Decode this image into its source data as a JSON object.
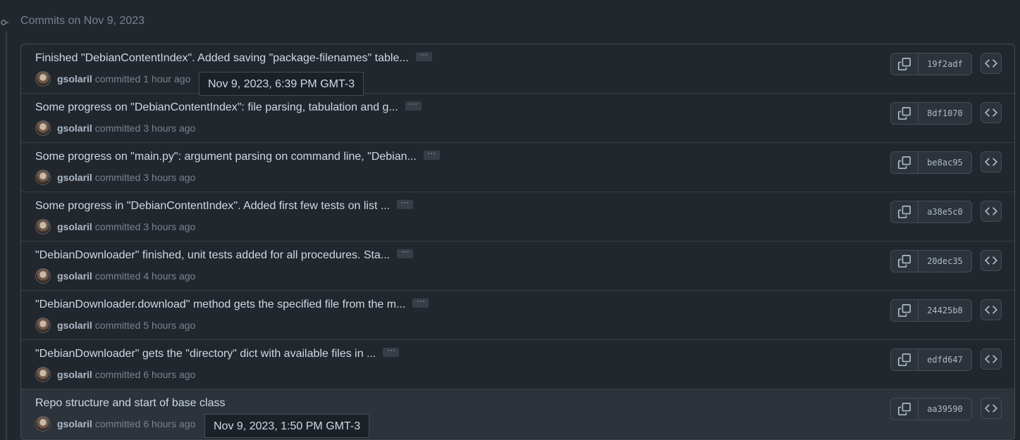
{
  "group": {
    "heading": "Commits on Nov 9, 2023"
  },
  "commits": [
    {
      "title": "Finished \"DebianContentIndex\". Added saving \"package-filenames\" table...",
      "ellipsis": "···",
      "author": "gsolaril",
      "verb": "committed",
      "time": "1 hour ago",
      "sha": "19f2adf"
    },
    {
      "title": "Some progress on \"DebianContentIndex\": file parsing, tabulation and g...",
      "ellipsis": "···",
      "author": "gsolaril",
      "verb": "committed",
      "time": "3 hours ago",
      "sha": "8df1070"
    },
    {
      "title": "Some progress on \"main.py\": argument parsing on command line, \"Debian...",
      "ellipsis": "···",
      "author": "gsolaril",
      "verb": "committed",
      "time": "3 hours ago",
      "sha": "be8ac95"
    },
    {
      "title": "Some progress in \"DebianContentIndex\". Added first few tests on list ...",
      "ellipsis": "···",
      "author": "gsolaril",
      "verb": "committed",
      "time": "3 hours ago",
      "sha": "a38e5c0"
    },
    {
      "title": "\"DebianDownloader\" finished, unit tests added for all procedures. Sta...",
      "ellipsis": "···",
      "author": "gsolaril",
      "verb": "committed",
      "time": "4 hours ago",
      "sha": "20dec35"
    },
    {
      "title": "\"DebianDownloader.download\" method gets the specified file from the m...",
      "ellipsis": "···",
      "author": "gsolaril",
      "verb": "committed",
      "time": "5 hours ago",
      "sha": "24425b8"
    },
    {
      "title": "\"DebianDownloader\" gets the \"directory\" dict with available files in ...",
      "ellipsis": "···",
      "author": "gsolaril",
      "verb": "committed",
      "time": "6 hours ago",
      "sha": "edfd647"
    },
    {
      "title": "Repo structure and start of base class",
      "ellipsis": "",
      "author": "gsolaril",
      "verb": "committed",
      "time": "6 hours ago",
      "sha": "aa39590"
    }
  ],
  "tooltips": {
    "first": "Nov 9, 2023, 6:39 PM GMT-3",
    "last": "Nov 9, 2023, 1:50 PM GMT-3"
  },
  "icons": {
    "copy": "copy-icon",
    "browse": "code-icon",
    "timeline": "git-commit-icon"
  },
  "colors": {
    "background": "#22272e",
    "row_hover": "#2d333b",
    "border": "#444c56",
    "title": "#cdd9e5",
    "muted": "#768390"
  }
}
